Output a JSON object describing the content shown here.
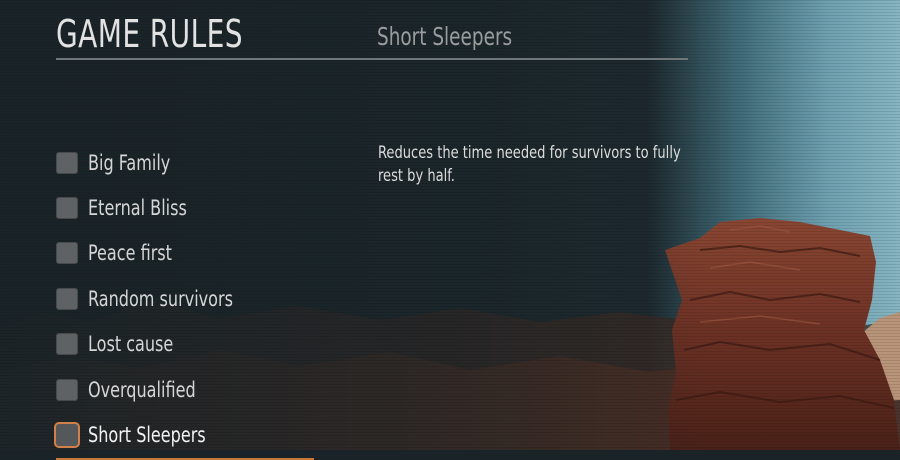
{
  "header": {
    "title": "GAME RULES",
    "selected_rule": "Short Sleepers"
  },
  "rules": [
    {
      "label": "Big Family",
      "checked": false,
      "selected": false
    },
    {
      "label": "Eternal Bliss",
      "checked": false,
      "selected": false
    },
    {
      "label": "Peace first",
      "checked": false,
      "selected": false
    },
    {
      "label": "Random survivors",
      "checked": false,
      "selected": false
    },
    {
      "label": "Lost cause",
      "checked": false,
      "selected": false
    },
    {
      "label": "Overqualified",
      "checked": false,
      "selected": false
    },
    {
      "label": "Short Sleepers",
      "checked": false,
      "selected": true
    }
  ],
  "description": "Reduces the time needed for survivors to fully rest by half.",
  "colors": {
    "accent": "#d08048",
    "panel": "#1a2428",
    "sky": "#6fa3b4",
    "rock": "#7a3a28"
  }
}
